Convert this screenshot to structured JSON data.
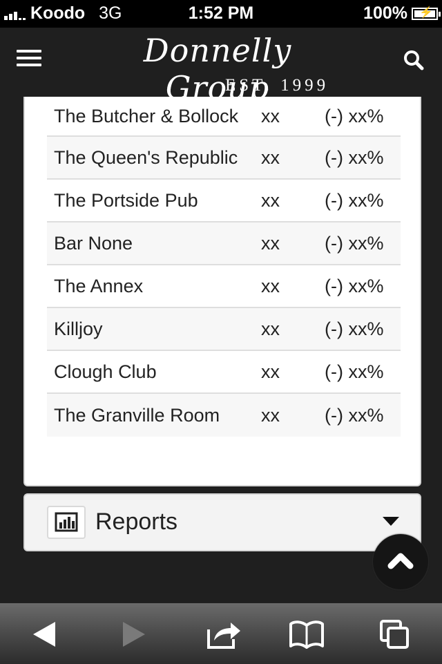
{
  "status_bar": {
    "carrier": "Koodo",
    "network": "3G",
    "time": "1:52 PM",
    "battery": "100%"
  },
  "header": {
    "logo_script": "Donnelly Group",
    "logo_est": "EST. 1999",
    "menu_icon": "hamburger-menu-icon",
    "search_icon": "search-icon"
  },
  "venues": [
    {
      "name": "The Butcher & Bollock",
      "value": "xx",
      "change": "(-) xx%"
    },
    {
      "name": "The Queen's Republic",
      "value": "xx",
      "change": "(-) xx%"
    },
    {
      "name": "The Portside Pub",
      "value": "xx",
      "change": "(-) xx%"
    },
    {
      "name": "Bar None",
      "value": "xx",
      "change": "(-) xx%"
    },
    {
      "name": "The Annex",
      "value": "xx",
      "change": "(-) xx%"
    },
    {
      "name": "Killjoy",
      "value": "xx",
      "change": "(-) xx%"
    },
    {
      "name": "Clough Club",
      "value": "xx",
      "change": "(-) xx%"
    },
    {
      "name": "The Granville Room",
      "value": "xx",
      "change": "(-) xx%"
    }
  ],
  "reports": {
    "label": "Reports",
    "icon": "bar-chart-icon",
    "caret_icon": "caret-down-icon"
  },
  "back_to_top_icon": "chevron-up-icon",
  "toolbar": {
    "icons": [
      "back-arrow-icon",
      "forward-arrow-icon",
      "share-icon",
      "bookmarks-icon",
      "tabs-icon"
    ]
  },
  "colors": {
    "background": "#1f1f1f",
    "card": "#ffffff",
    "row_alt": "#f7f7f7",
    "text": "#222222"
  }
}
